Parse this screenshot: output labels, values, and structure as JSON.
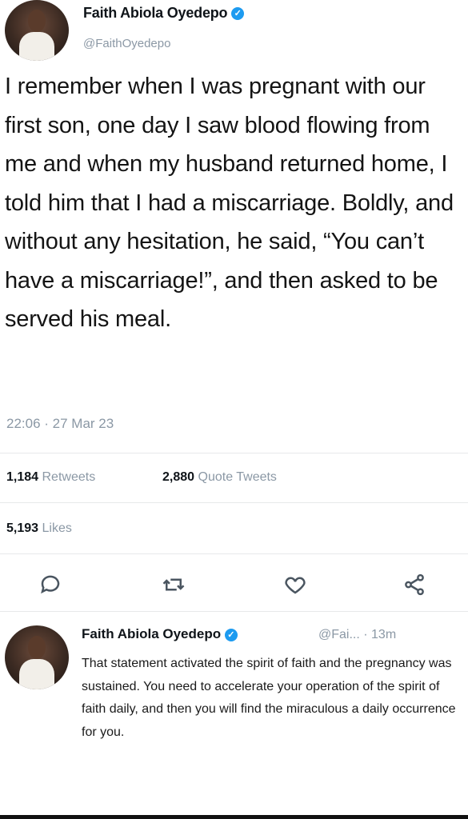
{
  "tweet": {
    "author_name": "Faith Abiola Oyedepo",
    "author_handle": "@FaithOyedepo",
    "text": "I remember when I was pregnant with our first son, one day I saw blood flowing from me and when my husband returned home, I told him that I had a miscarriage. Boldly, and without any hesitation, he said, “You can’t have a miscarriage!”, and then asked to be served his meal.",
    "timestamp": "22:06 · 27 Mar 23",
    "stats": {
      "retweets_count": "1,184",
      "retweets_label": "Retweets",
      "quotes_count": "2,880",
      "quotes_label": "Quote Tweets",
      "likes_count": "5,193",
      "likes_label": "Likes"
    }
  },
  "actions": [
    {
      "icon": "reply-icon"
    },
    {
      "icon": "retweet-icon"
    },
    {
      "icon": "like-icon"
    },
    {
      "icon": "share-icon"
    }
  ],
  "reply": {
    "author_name": "Faith Abiola Oyedepo",
    "handle_time": "@Fai... · 13m",
    "text": "That statement activated the spirit of faith and the pregnancy was sustained. You need to accelerate your operation of the spirit of faith daily, and then you will find the miraculous a daily occurrence for you."
  },
  "colors": {
    "verified": "#1d9bf0",
    "secondary_text": "#8b98a5",
    "primary_text": "#0f1419"
  }
}
